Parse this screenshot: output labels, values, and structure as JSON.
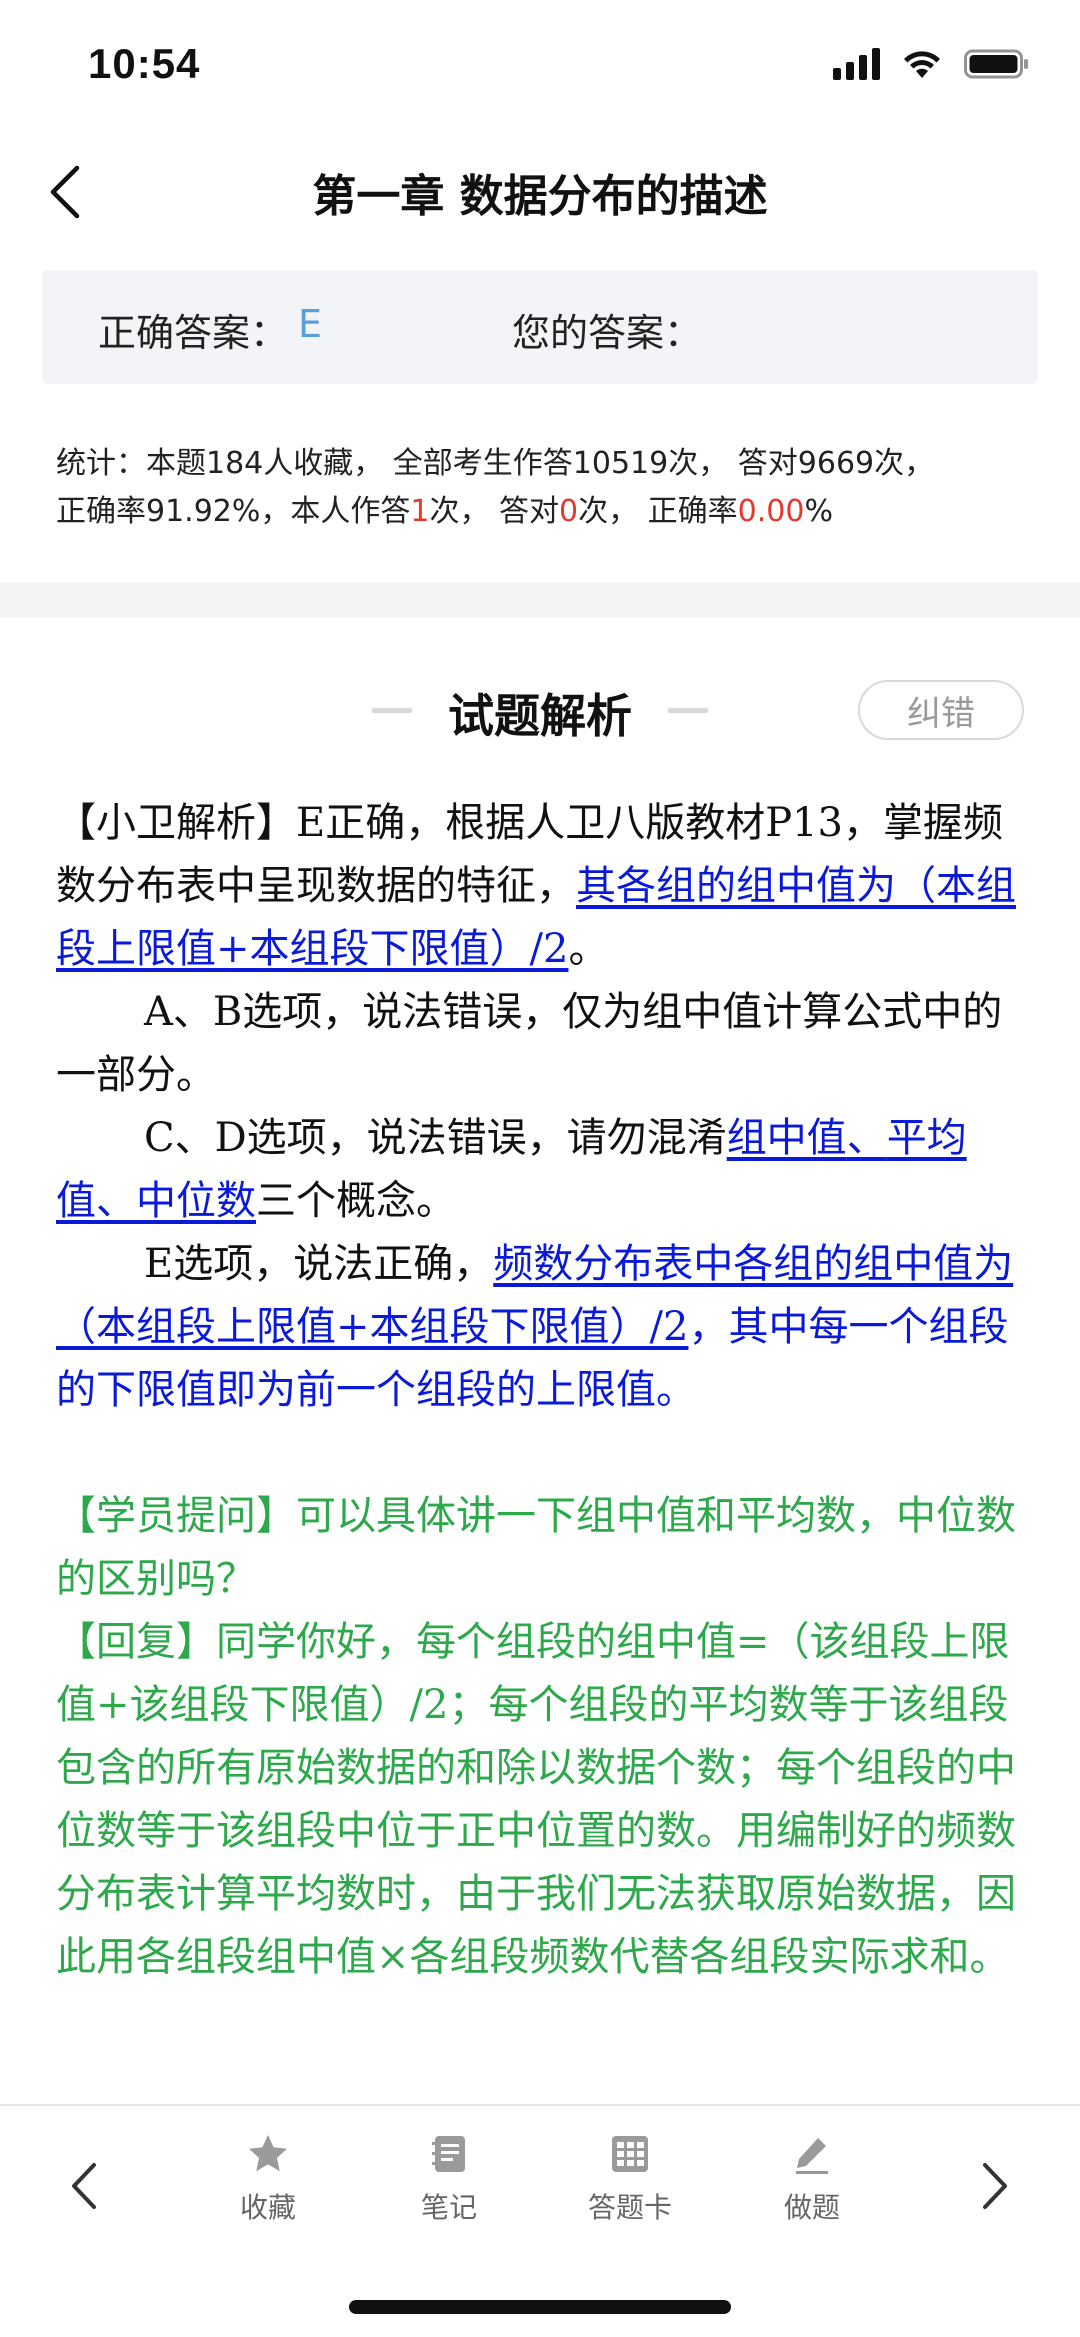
{
  "status": {
    "time": "10:54"
  },
  "header": {
    "title": "第一章 数据分布的描述"
  },
  "answer": {
    "correct_label": "正确答案：",
    "correct_value": "E",
    "mine_label": "您的答案："
  },
  "stats": {
    "line1": "统计：本题184人收藏， 全部考生作答10519次， 答对9669次，",
    "rate_label": "正确率91.92%，本人作答",
    "my_attempts": "1",
    "attempts_suffix": "次，  答对",
    "my_correct": "0",
    "correct_suffix": "次，  正确率",
    "my_rate": "0.00",
    "rate_suffix": "%"
  },
  "section": {
    "title": "试题解析",
    "report_button": "纠错"
  },
  "analysis": {
    "p1_text": "【小卫解析】E正确，根据人卫八版教材P13，掌握频数分布表中呈现数据的特征，",
    "p1_link": "其各组的组中值为（本组段上限值+本组段下限值）/2",
    "p1_end": "。",
    "p2": "A、B选项，说法错误，仅为组中值计算公式中的一部分。",
    "p3_text": "C、D选项，说法错误，请勿混淆",
    "p3_link1": "组中值",
    "p3_sep1": "、",
    "p3_link2": "平均值",
    "p3_sep2": "、",
    "p3_link3": "中位数",
    "p3_end": "三个概念。",
    "p4_text": "E选项，说法正确，",
    "p4_link": "频数分布表中各组的组中值为（本组段上限值+本组段下限值）/2",
    "p4_blue": "，其中每一个组段的下限值即为前一个组段的上限值。",
    "question": "【学员提问】可以具体讲一下组中值和平均数，中位数的区别吗？",
    "reply": "【回复】同学你好，每个组段的组中值=（该组段上限值+该组段下限值）/2；每个组段的平均数等于该组段包含的所有原始数据的和除以数据个数；每个组段的中位数等于该组段中位于正中位置的数。用编制好的频数分布表计算平均数时，由于我们无法获取原始数据，因此用各组段组中值×各组段频数代替各组段实际求和。"
  },
  "bottom_bar": {
    "favorite": "收藏",
    "notes": "笔记",
    "answer_card": "答题卡",
    "do_question": "做题"
  },
  "colors": {
    "link_blue": "#0a1ad8",
    "reply_green": "#2da84a",
    "stat_red": "#e23a2f",
    "answer_blue": "#5a9fd8"
  }
}
